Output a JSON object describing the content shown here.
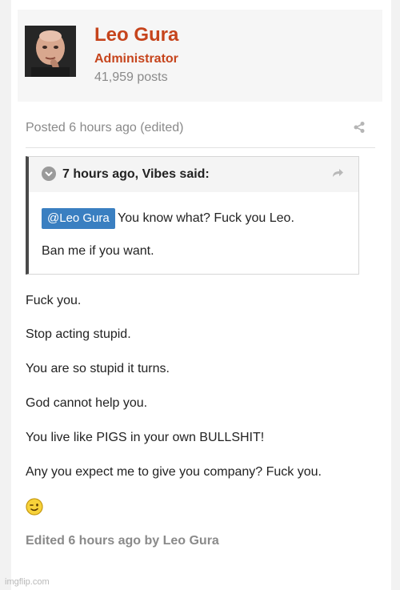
{
  "author": {
    "name": "Leo Gura",
    "role": "Administrator",
    "posts": "41,959 posts"
  },
  "post": {
    "posted_meta": "Posted 6 hours ago (edited)",
    "share_icon": "share-icon",
    "quote": {
      "citation": "7 hours ago, Vibes said:",
      "toggle_icon": "chevron-down-icon",
      "link_icon": "quote-link-arrow-icon",
      "mention": "@Leo Gura",
      "line_1": "You know what? Fuck you Leo.",
      "line_2": "Ban me if you want."
    },
    "body_lines": [
      "Fuck you.",
      "Stop acting stupid.",
      "You are so stupid it turns.",
      "God cannot help you.",
      "You live like PIGS in your own BULLSHIT!",
      "Any you expect me to give you company? Fuck you."
    ],
    "emoji_icon": "wink-emoji-icon",
    "edited_meta": "Edited 6 hours ago by Leo Gura"
  },
  "watermark": "imgflip.com",
  "colors": {
    "author_accent": "#c6441c",
    "mention_bg": "#3a7fc1",
    "muted_text": "#8a8a8a",
    "quote_bar": "#4a4a4a"
  }
}
